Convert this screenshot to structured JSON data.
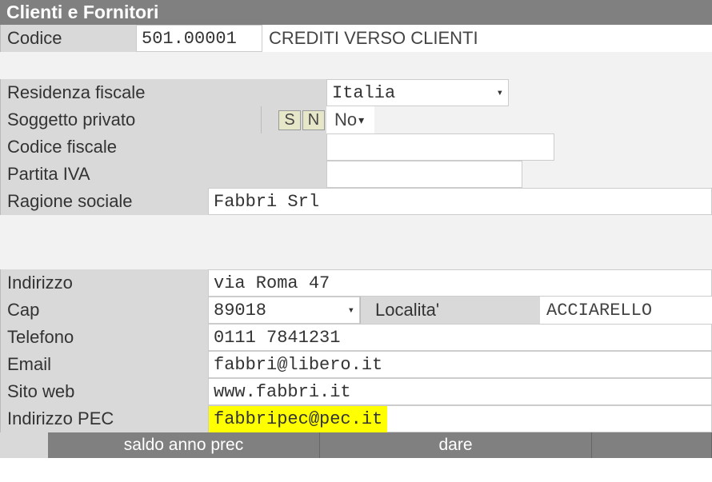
{
  "title": "Clienti e Fornitori",
  "codice": {
    "label": "Codice",
    "value": "501.00001",
    "desc": "CREDITI VERSO CLIENTI"
  },
  "residenza": {
    "label": "Residenza fiscale",
    "value": "Italia"
  },
  "soggetto": {
    "label": "Soggetto privato",
    "s": "S",
    "n": "N",
    "value": "No"
  },
  "codfisc": {
    "label": "Codice fiscale",
    "value": ""
  },
  "piva": {
    "label": "Partita IVA",
    "value": ""
  },
  "ragione": {
    "label": "Ragione sociale",
    "value": "Fabbri Srl"
  },
  "indirizzo": {
    "label": "Indirizzo",
    "value": "via Roma 47"
  },
  "cap": {
    "label": "Cap",
    "value": "89018",
    "loc_label": "Localita'",
    "loc_value": "ACCIARELLO"
  },
  "telefono": {
    "label": "Telefono",
    "value": "0111 7841231"
  },
  "email": {
    "label": "Email",
    "value": "fabbri@libero.it"
  },
  "sito": {
    "label": "Sito web",
    "value": "www.fabbri.it"
  },
  "pec": {
    "label": "Indirizzo PEC",
    "value": "fabbripec@pec.it"
  },
  "footer": {
    "saldo": "saldo anno prec",
    "dare": "dare"
  }
}
